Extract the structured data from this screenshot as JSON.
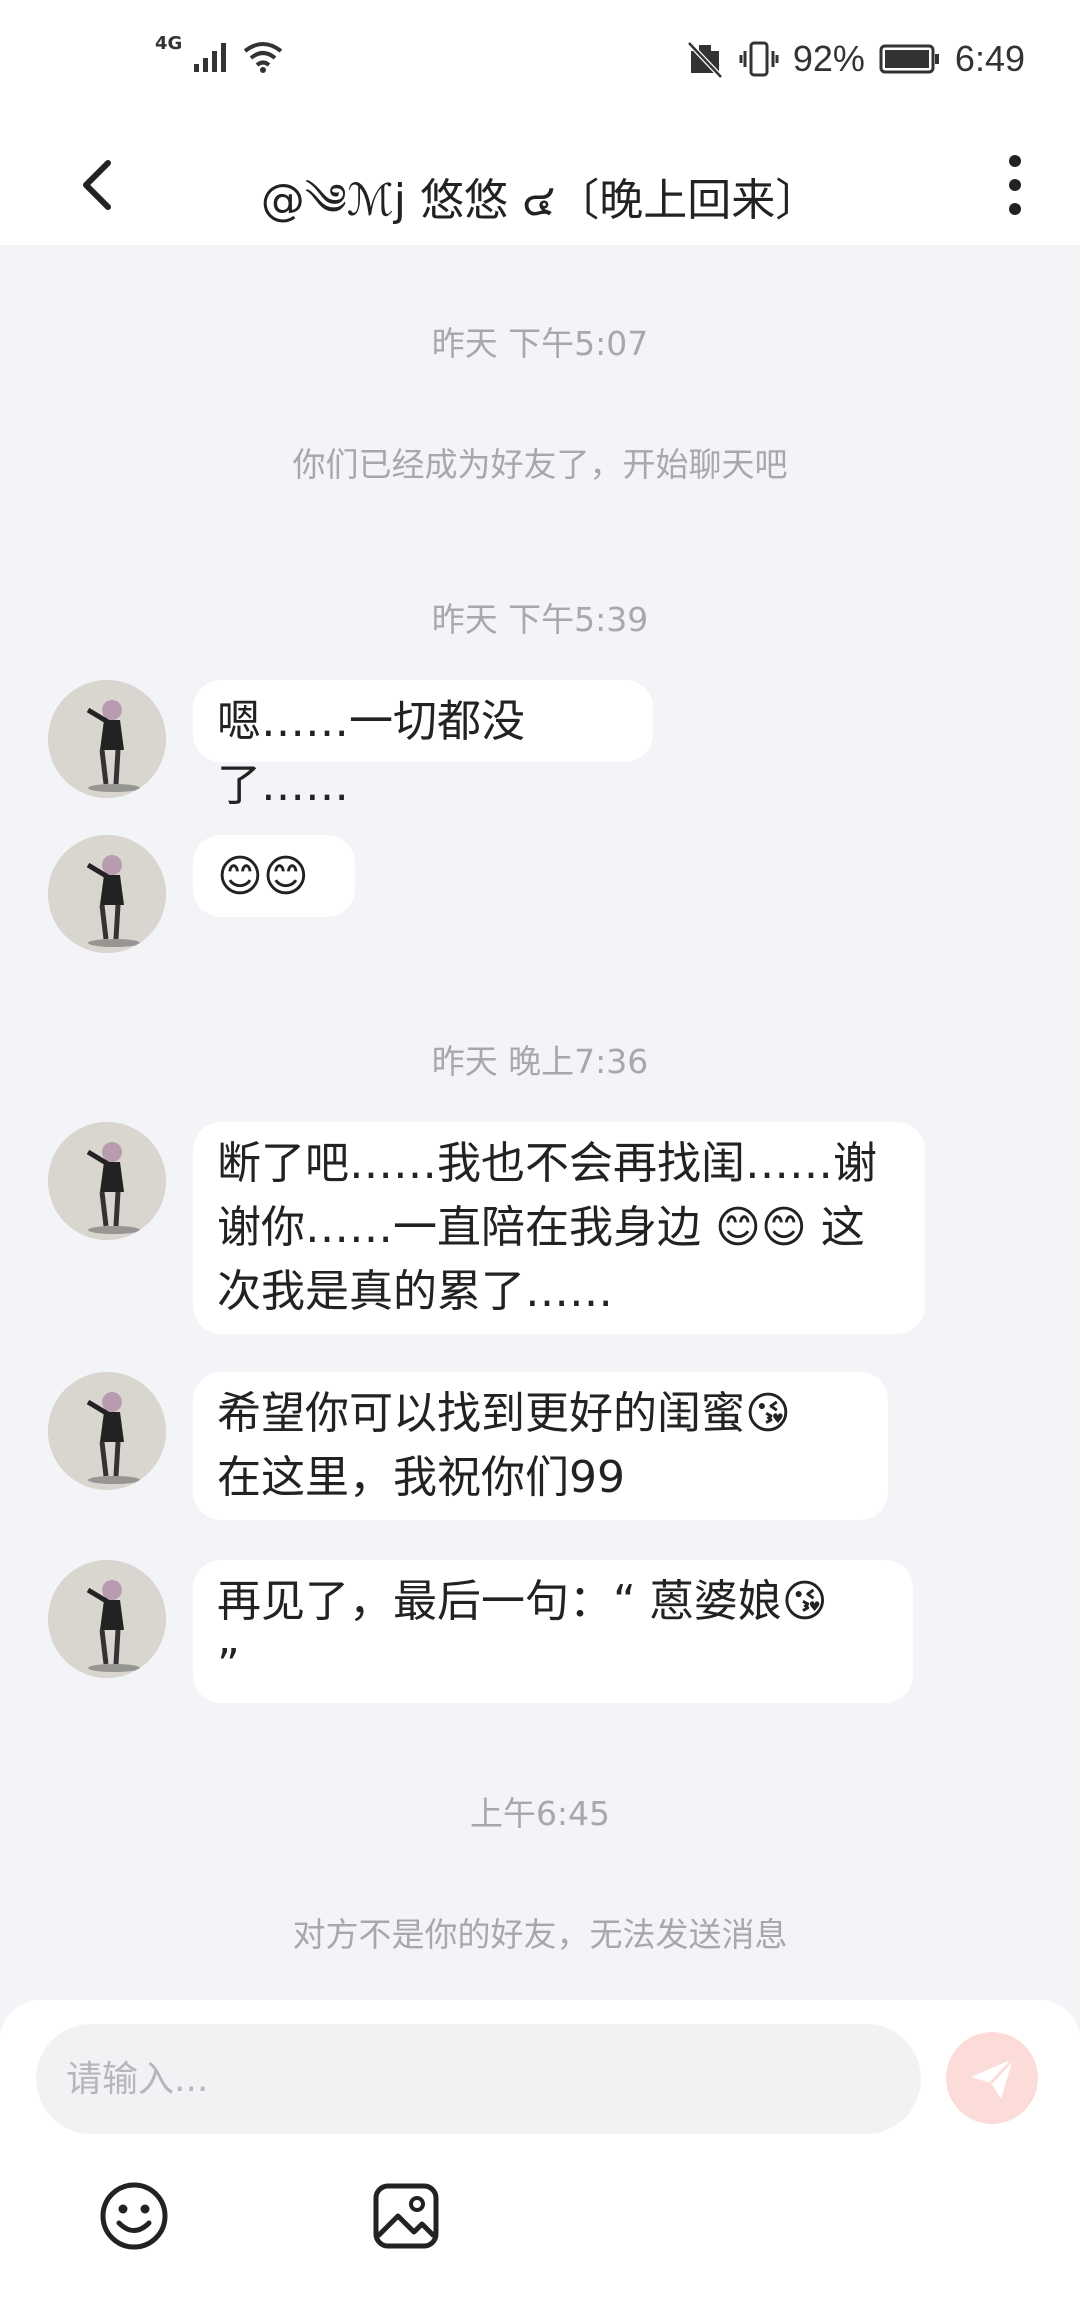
{
  "status_bar": {
    "network": "4G",
    "battery": "92%",
    "time": "6:49"
  },
  "header": {
    "title": "@༄ℳj 悠悠 ๔〔晚上回来〕",
    "back_icon": "chevron-left-icon",
    "more_icon": "more-vertical-icon"
  },
  "chat": {
    "sep1": "昨天 下午5:07",
    "system_friend": "你们已经成为好友了，开始聊天吧",
    "sep2": "昨天 下午5:39",
    "msg1": "嗯……一切都没了……",
    "msg2": "😊😊",
    "sep3": "昨天 晚上7:36",
    "msg3_line1": "断了吧……我也不会再找闺……谢",
    "msg3_line2": "谢你……一直陪在我身边 😊😊 这",
    "msg3_line3": "次我是真的累了……",
    "msg4_line1": "希望你可以找到更好的闺蜜😘",
    "msg4_line2": "在这里，我祝你们99",
    "msg5_line1": "再见了，最后一句：“ 蒽婆娘😘",
    "msg5_line2": "”",
    "sep4": "上午6:45",
    "system_not_friend": "对方不是你的好友，无法发送消息"
  },
  "input": {
    "placeholder": "请输入...",
    "value": ""
  },
  "toolbar": {
    "emoji_icon": "smiley-icon",
    "image_icon": "image-icon",
    "send_icon": "send-icon"
  },
  "colors": {
    "background": "#F3F4F7",
    "bubble": "#FFFFFF",
    "timestamp": "#A6A8AC",
    "send_button": "#FBDCD9",
    "send_glyph": "#FFFFFF"
  }
}
